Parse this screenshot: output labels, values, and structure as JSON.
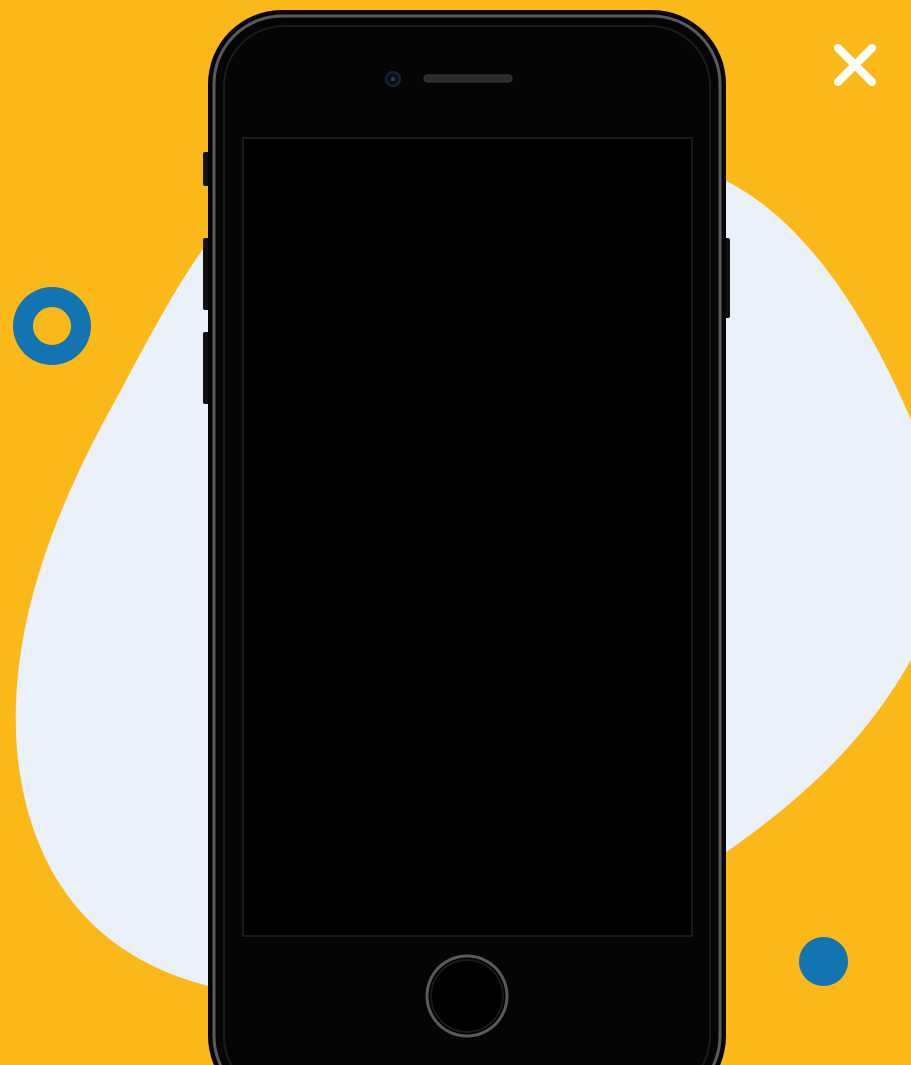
{
  "colors": {
    "background": "#FBB919",
    "blob": "#EAF1FB",
    "accent_blue": "#1275B1",
    "close_icon": "#FFFFFF",
    "phone_body": "#050505",
    "phone_screen": "#000000"
  },
  "icons": {
    "close": "close-icon",
    "home": "home-button-icon",
    "camera": "front-camera-icon",
    "speaker": "earpiece-speaker-icon"
  },
  "phone": {
    "screen_content": ""
  }
}
